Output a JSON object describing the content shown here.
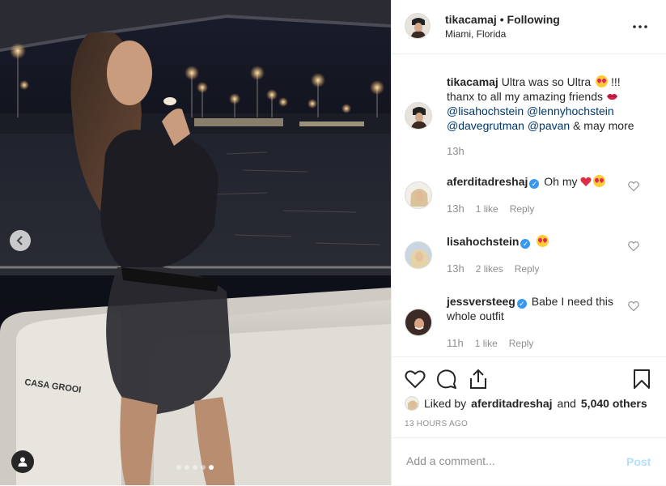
{
  "colors": {
    "accent": "#3897f0",
    "text": "#262626",
    "muted": "#8e8e8e",
    "heart": "#ed4956",
    "border": "#efefef"
  },
  "header": {
    "username": "tikacamaj",
    "separator": " • ",
    "follow_state": "Following",
    "location": "Miami, Florida",
    "more_icon": "more-horizontal-icon"
  },
  "caption": {
    "username": "tikacamaj",
    "text_start": "Ultra was so Ultra",
    "text_mid": " !!! thanx to all my amazing friends ",
    "mentions": [
      "@lisahochstein",
      "@lennyhochstein",
      "@davegrutman",
      "@pavan"
    ],
    "text_end": "& may more",
    "time": "13h"
  },
  "comments": [
    {
      "username": "aferditadreshaj",
      "text": "Oh my",
      "time": "13h",
      "likes": "1 like",
      "reply": "Reply"
    },
    {
      "username": "lisahochstein",
      "text": "",
      "time": "13h",
      "likes": "2 likes",
      "reply": "Reply"
    },
    {
      "username": "jessversteeg",
      "text": "Babe I need this whole outfit",
      "time": "11h",
      "likes": "1 like",
      "reply": "Reply"
    }
  ],
  "photo": {
    "carousel_count": 5,
    "carousel_active_index": 4,
    "boat_text": "CASA GROOI"
  },
  "likes": {
    "prefix": "Liked by",
    "user": "aferditadreshaj",
    "and": "and",
    "count": "5,040 others"
  },
  "timestamp": "13 HOURS AGO",
  "comment_input": {
    "placeholder": "Add a comment...",
    "post_label": "Post"
  }
}
